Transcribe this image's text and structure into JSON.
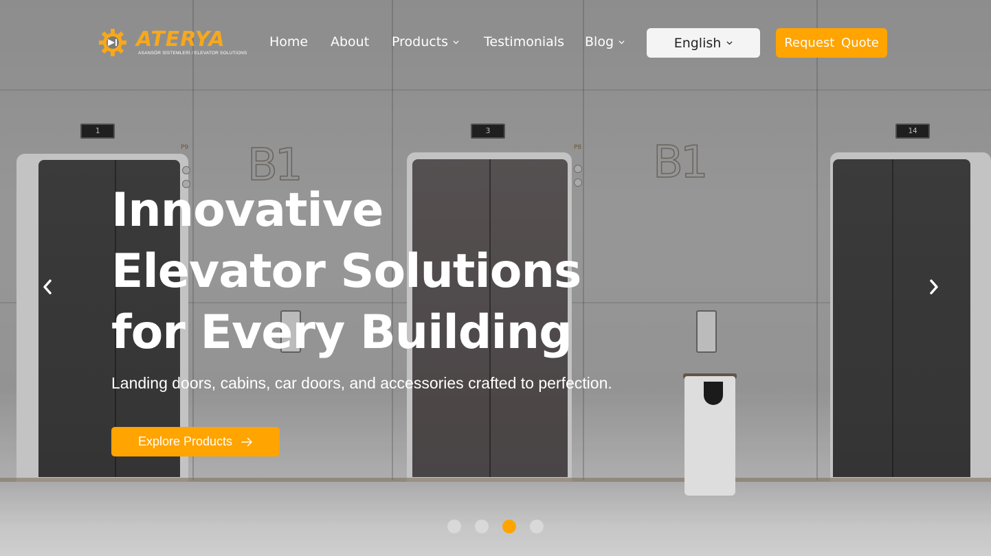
{
  "brand": {
    "logo_text": "ATERYA",
    "tagline": "ASANSÖR SİSTEMLERİ / ELEVATOR SOLUTIONS",
    "logo_icon": "gear-play-icon",
    "accent_color": "#ffa400"
  },
  "nav": {
    "items": [
      {
        "label": "Home",
        "has_dropdown": false
      },
      {
        "label": "About",
        "has_dropdown": false
      },
      {
        "label": "Products",
        "has_dropdown": true
      },
      {
        "label": "Testimonials",
        "has_dropdown": false
      },
      {
        "label": "Blog",
        "has_dropdown": true
      }
    ],
    "language": "English",
    "quote_button": "Request Quote"
  },
  "hero": {
    "title_lines": [
      "Innovative",
      "Elevator Solutions",
      "for Every Building"
    ],
    "subtitle": "Landing doors, cabins, car doors, and accessories crafted to perfection.",
    "cta_label": "Explore Products",
    "cta_icon": "arrow-right-icon",
    "prev_icon": "chevron-left-icon",
    "next_icon": "chevron-right-icon"
  },
  "scene": {
    "floor_displays": [
      "1",
      "3",
      "14"
    ],
    "wall_labels": [
      "B1",
      "B1"
    ],
    "door_labels": [
      "P9",
      "P8"
    ]
  },
  "carousel": {
    "slide_count": 4,
    "active_slide": 3
  }
}
